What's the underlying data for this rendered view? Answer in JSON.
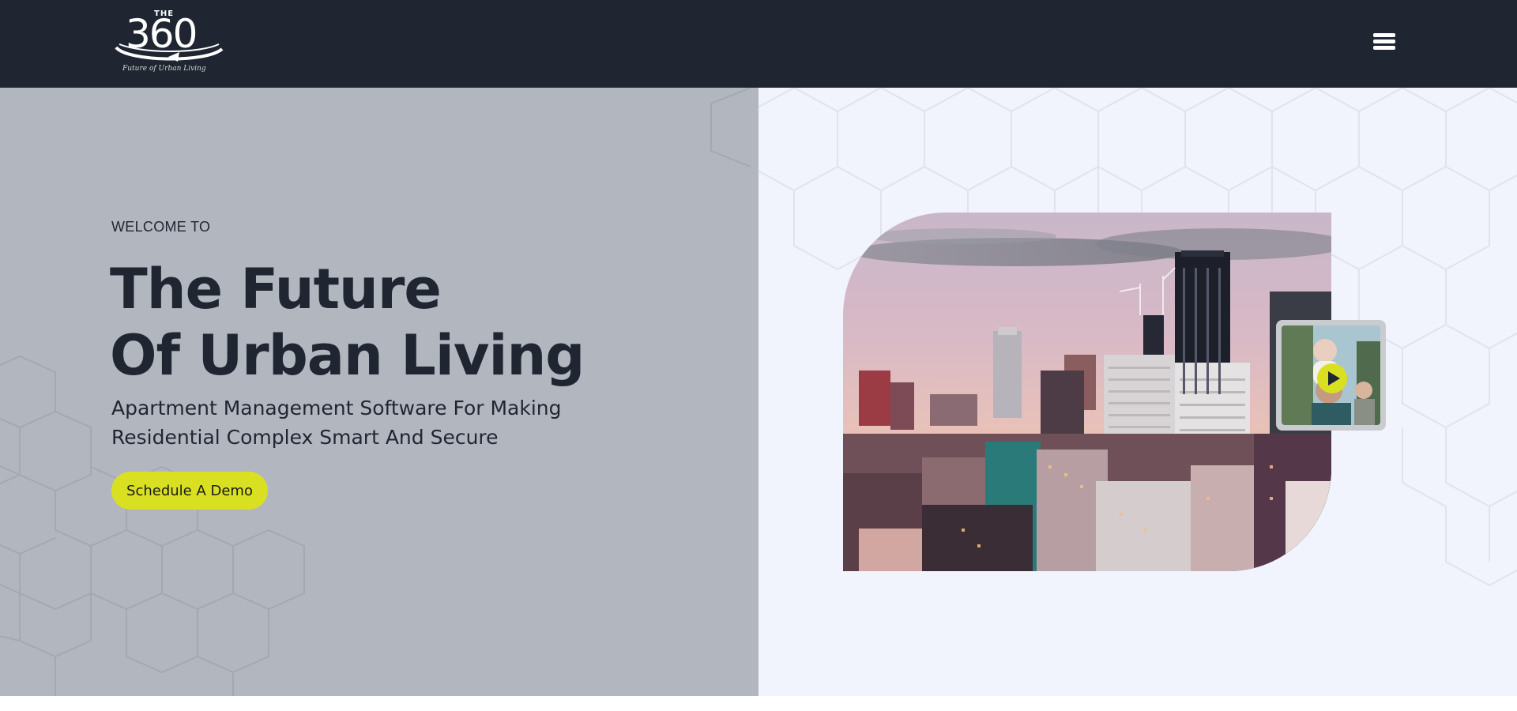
{
  "header": {
    "logo": {
      "the": "THE",
      "number": "360",
      "tagline": "Future of Urban Living"
    },
    "menu_icon": "hamburger-menu-icon"
  },
  "hero": {
    "kicker": "WELCOME TO",
    "title_line1": "The Future",
    "title_line2": "Of Urban Living",
    "subtitle_line1": "Apartment Management Software For Making",
    "subtitle_line2": "Residential Complex Smart And Secure",
    "cta_label": "Schedule A Demo"
  },
  "media": {
    "main_image": "city-skyline-image",
    "video_thumbnail": "family-video-thumbnail",
    "play_icon": "play-icon"
  },
  "colors": {
    "header_bg": "#1f2631",
    "left_panel_bg": "#b2b6bf",
    "right_panel_bg": "#f1f4fd",
    "accent": "#d9e021",
    "text_dark": "#1f2631"
  }
}
